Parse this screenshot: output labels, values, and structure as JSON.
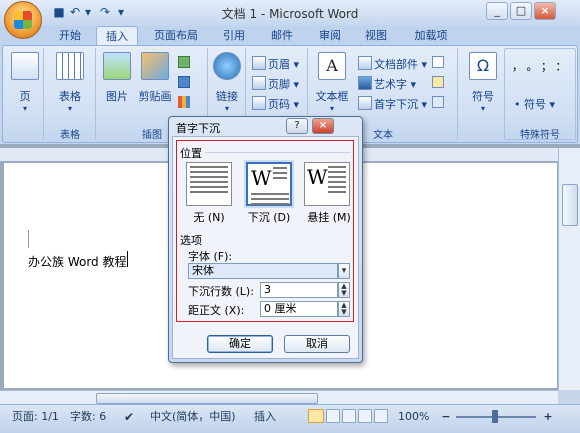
{
  "window": {
    "title": "文档 1 - Microsoft Word",
    "min": "_",
    "max": "□",
    "close": "×"
  },
  "qat": {
    "save": "■",
    "undo": "↶",
    "undo_drop": "▾",
    "redo": "↷",
    "more": "▾"
  },
  "tabs": [
    {
      "label": "开始"
    },
    {
      "label": "插入"
    },
    {
      "label": "页面布局"
    },
    {
      "label": "引用"
    },
    {
      "label": "邮件"
    },
    {
      "label": "审阅"
    },
    {
      "label": "视图"
    },
    {
      "label": "加载项"
    }
  ],
  "active_tab": "插入",
  "ribbon": {
    "pages": {
      "label": "页"
    },
    "table": {
      "btn": "表格",
      "group": "表格"
    },
    "illus": {
      "picture": "图片",
      "clipart": "剪贴画",
      "group": "插图"
    },
    "links": {
      "btn": "链接"
    },
    "header_footer": {
      "header": "页眉",
      "footer": "页脚",
      "page_no": "页码"
    },
    "text": {
      "textbox": "文本框",
      "quickparts": "文档部件",
      "wordart": "艺术字",
      "dropcap": "首字下沉",
      "group": "文本"
    },
    "symbols": {
      "symbol": "符号",
      "symbol_btn": "符号",
      "special": "特殊符号",
      "chars": "， 。 ； ："
    }
  },
  "document": {
    "text": "办公族 Word 教程"
  },
  "statusbar": {
    "page": "页面: 1/1",
    "words": "字数: 6",
    "lang": "中文(简体，中国)",
    "mode": "插入",
    "zoom": "100%",
    "minus": "−",
    "plus": "+"
  },
  "dialog": {
    "title": "首字下沉",
    "help": "?",
    "close": "×",
    "position_label": "位置",
    "positions": [
      {
        "label": "无 (N)"
      },
      {
        "label": "下沉 (D)"
      },
      {
        "label": "悬挂 (M)"
      }
    ],
    "tile_letter": "W",
    "options_label": "选项",
    "font_label": "字体 (F):",
    "font_value": "宋体",
    "lines_label": "下沉行数 (L):",
    "lines_value": "3",
    "distance_label": "距正文 (X):",
    "distance_value": "0 厘米",
    "ok": "确定",
    "cancel": "取消"
  }
}
